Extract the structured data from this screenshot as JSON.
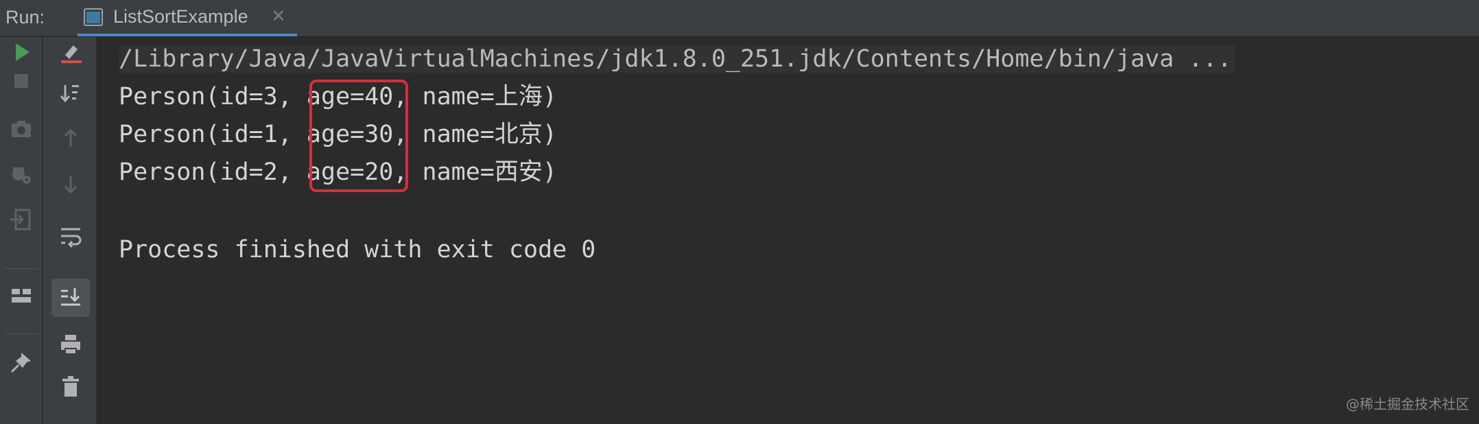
{
  "header": {
    "run_label": "Run:",
    "tab_label": "ListSortExample",
    "tab_close": "✕"
  },
  "toolbar_left": [
    "run-icon",
    "stop-icon",
    "camera-icon",
    "debug-settings-icon",
    "exit-icon",
    "layout-icon",
    "pin-icon"
  ],
  "toolbar_right": [
    "clear-console-icon",
    "sort-icon",
    "arrow-up-icon",
    "arrow-down-icon",
    "soft-wrap-icon",
    "scroll-to-end-icon",
    "print-icon",
    "trash-icon"
  ],
  "console": {
    "command": "/Library/Java/JavaVirtualMachines/jdk1.8.0_251.jdk/Contents/Home/bin/java ...",
    "lines": [
      "Person(id=3, age=40, name=上海)",
      "Person(id=1, age=30, name=北京)",
      "Person(id=2, age=20, name=西安)"
    ],
    "exit_message": "Process finished with exit code 0"
  },
  "watermark": "@稀土掘金技术社区",
  "colors": {
    "background": "#2b2b2b",
    "toolbar": "#3c3f41",
    "text": "#d4d4d4",
    "highlight": "#d3303d",
    "run_green": "#499c54"
  }
}
